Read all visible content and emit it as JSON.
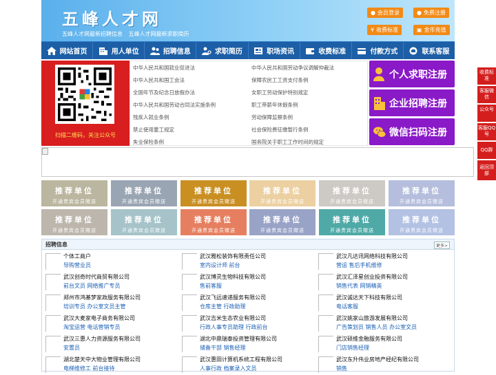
{
  "site": {
    "logo": "五峰人才网",
    "slogans": [
      "五峰人才网最新招聘信息",
      "五峰人才网最新求职简历"
    ]
  },
  "header_buttons": {
    "login": "会员登录",
    "register": "免费注册",
    "pricing": "收费标准",
    "recharge": "金币充值"
  },
  "nav": [
    "网站首页",
    "用人单位",
    "招聘信息",
    "求职简历",
    "职场资讯",
    "收费标准",
    "付款方式",
    "联系客服"
  ],
  "qr_caption": "扫描二维码，关注公众号",
  "laws": [
    "中华人民共和国就业促进法",
    "中华人民共和国劳动争议调解仲裁法",
    "中华人民共和国工会法",
    "保障农民工工资支付条例",
    "全国年节及纪念日放假办法",
    "女职工劳动保护特别规定",
    "中华人民共和国劳动合同法实施条例",
    "职工带薪年休假条例",
    "残疾人就业条例",
    "劳动保障监察条例",
    "禁止使用童工规定",
    "社会保险费征缴暂行条例",
    "失业保险条例",
    "国务院关于职工工作时间的规定"
  ],
  "register_buttons": [
    "个人求职注册",
    "企业招聘注册",
    "微信扫码注册"
  ],
  "colors": {
    "nav": "#1d5fa6",
    "register": "#8a19c8",
    "orange": "#f28a16",
    "side": "#d41e1e"
  },
  "ads": {
    "title": "推荐单位",
    "subtitle": "开通贵宾会员赠送",
    "colors": [
      "#bab69f",
      "#9aa5b3",
      "#c98f22",
      "#ecd0a1",
      "#cdc9c4",
      "#b5bedc",
      "#bdb6ad",
      "#a5c3c8",
      "#e67f60",
      "#99a3c7",
      "#4fa9a7",
      "#b3c1e3"
    ]
  },
  "jobs_section": {
    "title": "招聘信息",
    "more": "更多>"
  },
  "jobs": [
    {
      "company": "个体工商户",
      "positions": "导购营业员"
    },
    {
      "company": "武汉雅松装饰有限责任公司",
      "positions": "室内设计师  前台"
    },
    {
      "company": "武汉凡达讯网络科技有限公司",
      "positions": "营运  售后手机维修"
    },
    {
      "company": "武汉创奇时代商贸有限公司",
      "positions": "前台文员  网络推广专员"
    },
    {
      "company": "武汉博灵生物科技有限公司",
      "positions": "售前客服"
    },
    {
      "company": "武汉汇泽星创业投资有限公司",
      "positions": "销售代表  网销精英"
    },
    {
      "company": "郑州市鸿基梦家政服务有限公司",
      "positions": "培训专员  办公室文员主管"
    },
    {
      "company": "武汉飞远速递服务有限公司",
      "positions": "仓库主管  行政助理"
    },
    {
      "company": "武汉诚达天下科技有限公司",
      "positions": "电话客服"
    },
    {
      "company": "武汉大麦家电子商务有限公司",
      "positions": "淘宝运营  电话营销专员"
    },
    {
      "company": "武汉吉米生态农业有限公司",
      "positions": "行政人事专员助理  行政前台"
    },
    {
      "company": "武汉姚家山旅游发展有限公司",
      "positions": "广告策划员  销售人员  办公室文员"
    },
    {
      "company": "武汉三惠人力资源服务有限公司",
      "positions": "安置员"
    },
    {
      "company": "湖北中鼎瑞泰投资管理有限公司",
      "positions": "储备干部  销售经理"
    },
    {
      "company": "武汉硕维金融服务有限公司",
      "positions": "门店销售经理"
    },
    {
      "company": "湖北楚天中大物业管理有限公司",
      "positions": "电梯维修工  前台接待"
    },
    {
      "company": "武汉惠田计算机系统工程有限公司",
      "positions": "人事行政  档案录入文员"
    },
    {
      "company": "武汉东升伟业房地产经纪有限公司",
      "positions": "销售"
    }
  ],
  "side_bar": [
    "收费标准",
    "客服微信",
    "公众号",
    "客服QQ号",
    "QQ群",
    "返回顶部"
  ]
}
